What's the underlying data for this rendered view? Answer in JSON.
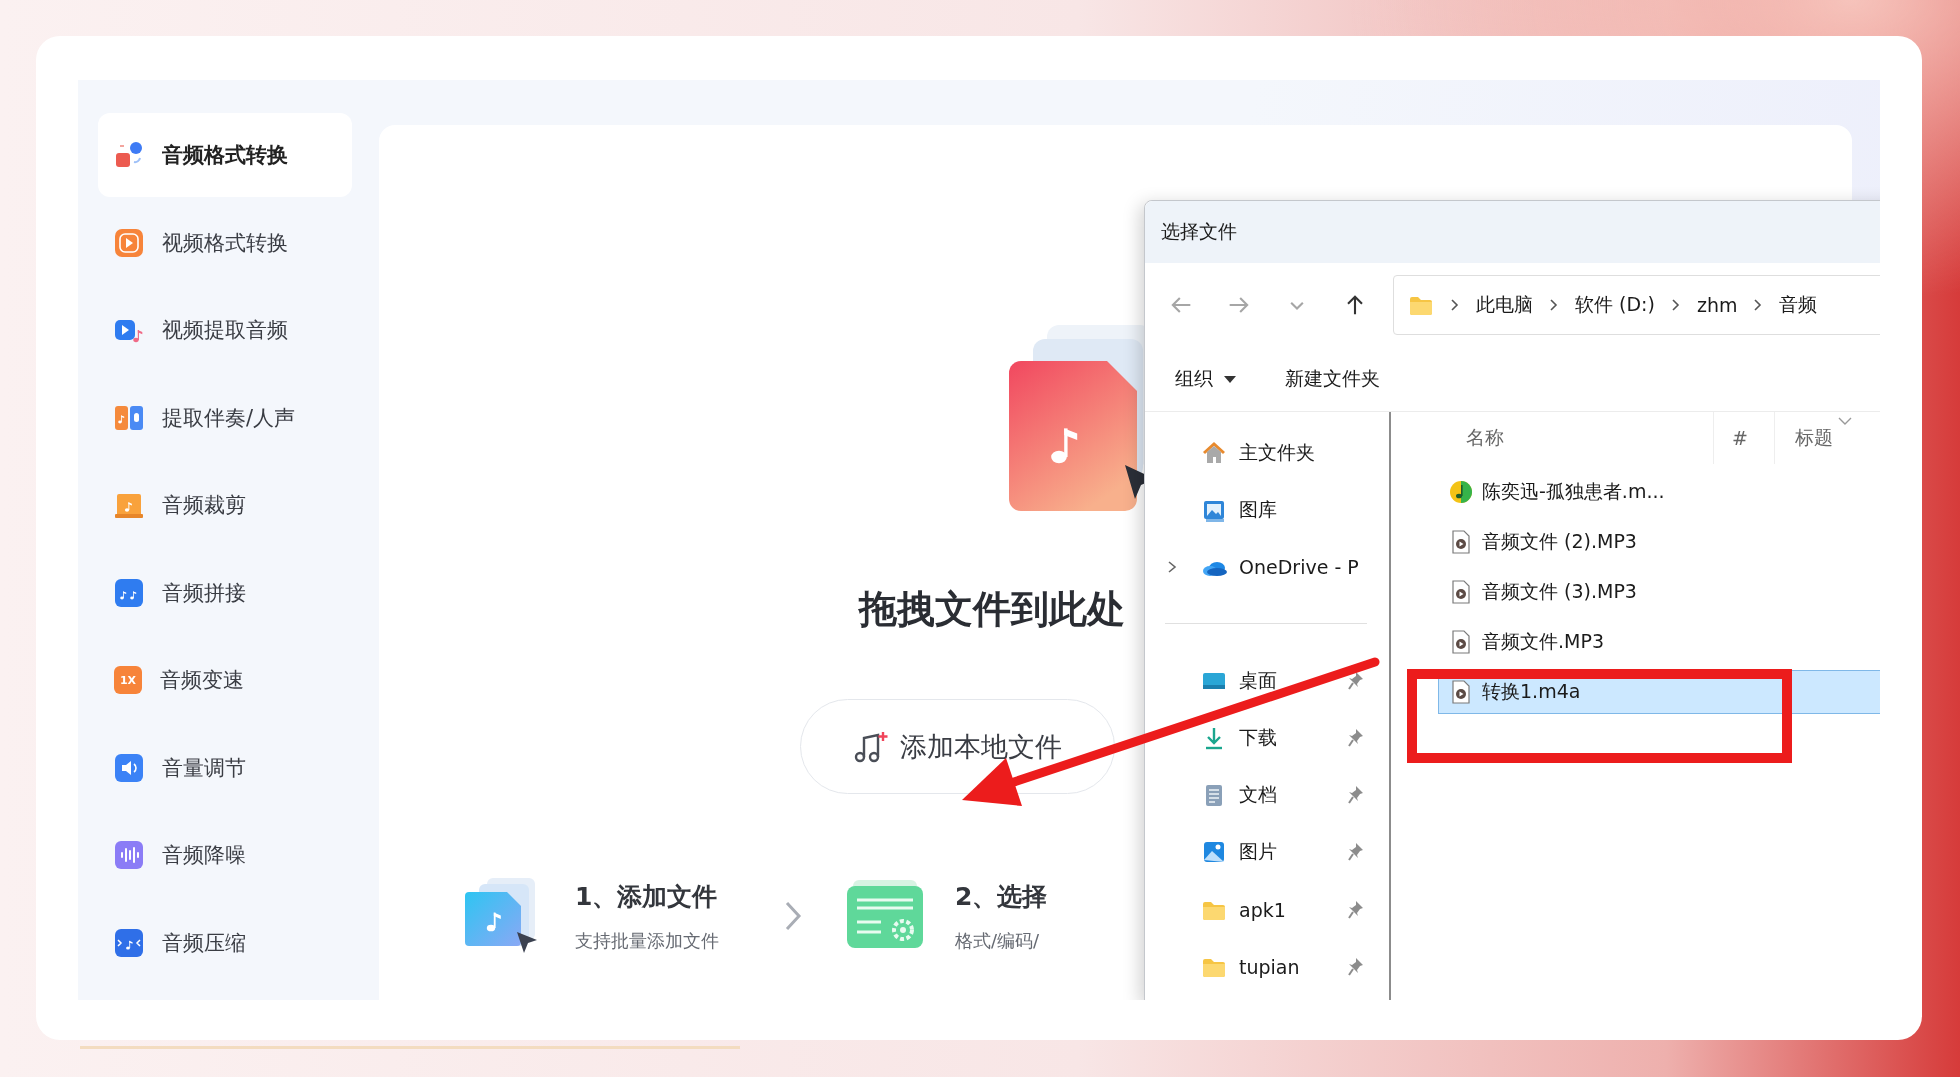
{
  "sidebar": {
    "items": [
      {
        "label": "音频格式转换",
        "kind": "format",
        "selected": true
      },
      {
        "label": "视频格式转换",
        "kind": "video",
        "selected": false
      },
      {
        "label": "视频提取音频",
        "kind": "extract",
        "selected": false
      },
      {
        "label": "提取伴奏/人声",
        "kind": "separate",
        "selected": false
      },
      {
        "label": "音频裁剪",
        "kind": "cut",
        "selected": false
      },
      {
        "label": "音频拼接",
        "kind": "join",
        "selected": false
      },
      {
        "label": "音频变速",
        "kind": "speed",
        "icon_text": "1X",
        "selected": false
      },
      {
        "label": "音量调节",
        "kind": "volume",
        "selected": false
      },
      {
        "label": "音频降噪",
        "kind": "denoise",
        "selected": false
      },
      {
        "label": "音频压缩",
        "kind": "compress",
        "selected": false
      }
    ]
  },
  "main": {
    "heading": "拖拽文件到此处",
    "add_button": "添加本地文件",
    "steps": [
      {
        "title": "1、添加文件",
        "description": "支持批量添加文件",
        "kind": "add"
      },
      {
        "title": "2、选择",
        "description": "格式/编码/",
        "kind": "settings"
      }
    ]
  },
  "dialog": {
    "title": "选择文件",
    "nav_buttons": [
      {
        "kind": "back",
        "disabled": true
      },
      {
        "kind": "forward",
        "disabled": true
      },
      {
        "kind": "recent",
        "disabled": true
      },
      {
        "kind": "up",
        "disabled": false
      }
    ],
    "path": [
      "此电脑",
      "软件 (D:)",
      "zhm",
      "音频"
    ],
    "toolbar": [
      {
        "label": "组织",
        "dropdown": true
      },
      {
        "label": "新建文件夹",
        "dropdown": false
      }
    ],
    "nav_sections": [
      {
        "items": [
          {
            "label": "主文件夹",
            "kind": "home",
            "expandable": false,
            "pinned": false
          },
          {
            "label": "图库",
            "kind": "gallery",
            "expandable": false,
            "pinned": false
          },
          {
            "label": "OneDrive - P",
            "kind": "cloud",
            "expandable": true,
            "pinned": false
          }
        ]
      },
      {
        "items": [
          {
            "label": "桌面",
            "kind": "desktop",
            "expandable": false,
            "pinned": true
          },
          {
            "label": "下载",
            "kind": "download",
            "expandable": false,
            "pinned": true
          },
          {
            "label": "文档",
            "kind": "document",
            "expandable": false,
            "pinned": true
          },
          {
            "label": "图片",
            "kind": "pictures",
            "expandable": false,
            "pinned": true
          },
          {
            "label": "apk1",
            "kind": "folder",
            "expandable": false,
            "pinned": true
          },
          {
            "label": "tupian",
            "kind": "folder",
            "expandable": false,
            "pinned": true
          }
        ]
      }
    ],
    "columns": [
      "名称",
      "#",
      "标题"
    ],
    "files": [
      {
        "name": "陈奕迅-孤独患者.m...",
        "kind": "music-app",
        "selected": false
      },
      {
        "name": "音频文件 (2).MP3",
        "kind": "audio-file",
        "selected": false
      },
      {
        "name": "音频文件 (3).MP3",
        "kind": "audio-file",
        "selected": false
      },
      {
        "name": "音频文件.MP3",
        "kind": "audio-file",
        "selected": false
      },
      {
        "name": "转换1.m4a",
        "kind": "audio-file",
        "selected": true
      }
    ]
  }
}
